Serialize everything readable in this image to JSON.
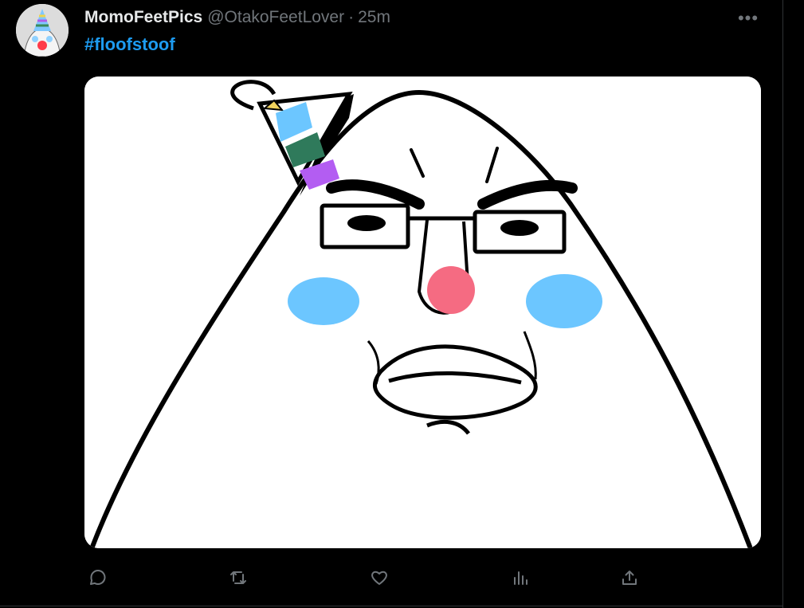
{
  "tweet": {
    "author_name": "MomoFeetPics",
    "author_handle": "@OtakoFeetLover",
    "separator": "·",
    "timestamp": "25m",
    "more_label": "•••",
    "text": "#floofstoof"
  },
  "colors": {
    "background": "#000000",
    "text_primary": "#e7e9ea",
    "text_secondary": "#71767b",
    "link": "#1d9bf0",
    "blush": "#6cc6ff",
    "nose": "#f56b82"
  },
  "icons": {
    "reply": "reply-icon",
    "retweet": "retweet-icon",
    "like": "heart-icon",
    "views": "views-icon",
    "share": "share-icon"
  }
}
